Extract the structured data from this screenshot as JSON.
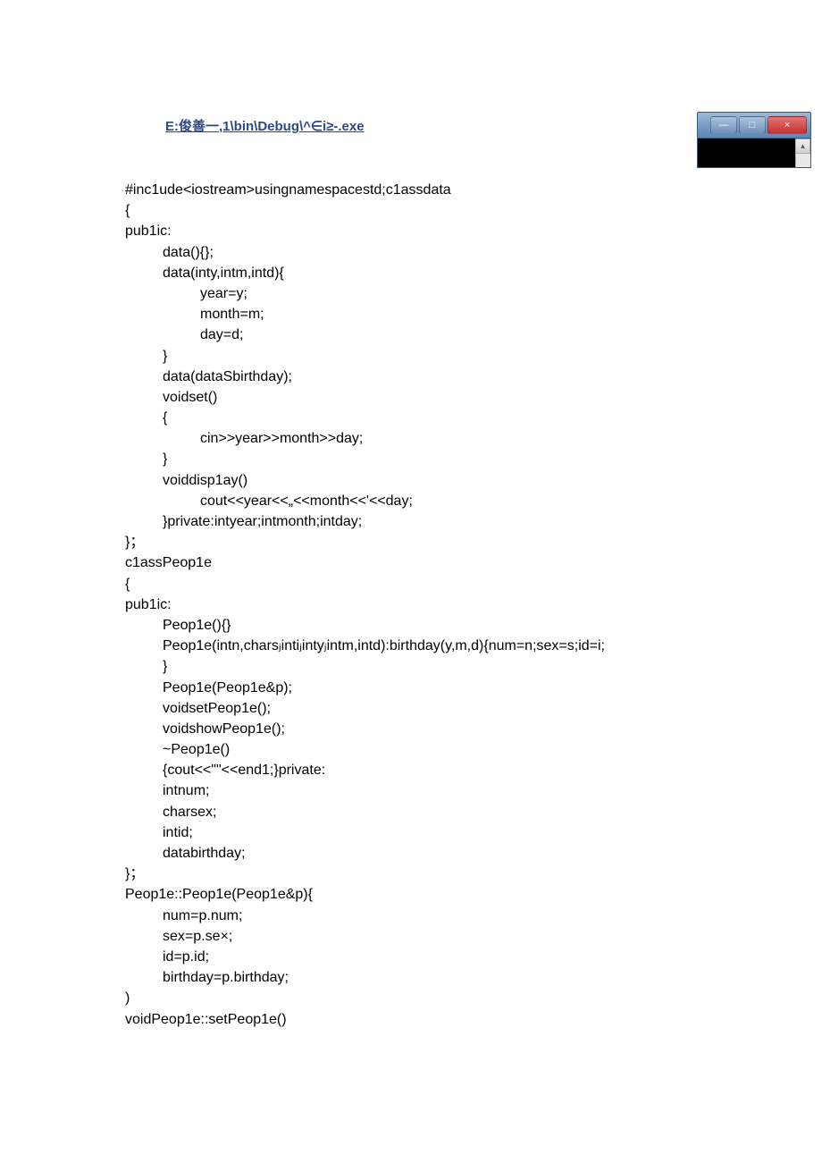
{
  "title_link": "E:俊善一,1\\bin\\Debug\\^∈i≥-.exe",
  "code_lines": [
    {
      "cls": "",
      "t": "#inc1ude<iostream>usingnamespacestd;c1assdata"
    },
    {
      "cls": "",
      "t": "{"
    },
    {
      "cls": "",
      "t": "pub1ic:"
    },
    {
      "cls": "indent1",
      "t": "data(){};"
    },
    {
      "cls": "indent1",
      "t": "data(inty,intm,intd){"
    },
    {
      "cls": "indent2",
      "t": "year=y;"
    },
    {
      "cls": "indent2",
      "t": "month=m;"
    },
    {
      "cls": "indent2",
      "t": "day=d;"
    },
    {
      "cls": "indent1",
      "t": "}"
    },
    {
      "cls": "indent1",
      "t": "data(dataSbirthday);"
    },
    {
      "cls": "indent1",
      "t": "voidset()"
    },
    {
      "cls": "indent1",
      "t": "{"
    },
    {
      "cls": "indent2",
      "t": "cin>>year>>month>>day;"
    },
    {
      "cls": "indent1",
      "t": "}"
    },
    {
      "cls": "indent1",
      "t": "voiddisp1ay()"
    },
    {
      "cls": "indent2",
      "t": "cout<<year<<„<<month<<'<<day;"
    },
    {
      "cls": "indent1",
      "t": "}private:intyear;intmonth;intday;"
    },
    {
      "cls": "",
      "t": "}；"
    },
    {
      "cls": "",
      "t": "c1assPeop1e"
    },
    {
      "cls": "",
      "t": "{"
    },
    {
      "cls": "",
      "t": "pub1ic:"
    },
    {
      "cls": "indent1",
      "t": "Peop1e(){}"
    },
    {
      "cls": "indent1",
      "t": "Peop1e(intn,charsⱼintiⱼintyⱼintm,intd):birthday(y,m,d){num=n;sex=s;id=i;"
    },
    {
      "cls": "indent1",
      "t": "}"
    },
    {
      "cls": "indent1",
      "t": "Peop1e(Peop1e&p);"
    },
    {
      "cls": "indent1",
      "t": "voidsetPeop1e();"
    },
    {
      "cls": "indent1",
      "t": "voidshowPeop1e();"
    },
    {
      "cls": "indent1",
      "t": "~Peop1e()"
    },
    {
      "cls": "indent1",
      "t": "{cout<<\"\"<<end1;}private:"
    },
    {
      "cls": "indent1",
      "t": "intnum;"
    },
    {
      "cls": "indent1",
      "t": "charsex;"
    },
    {
      "cls": "indent1",
      "t": "intid;"
    },
    {
      "cls": "indent1",
      "t": "databirthday;"
    },
    {
      "cls": "",
      "t": "}；"
    },
    {
      "cls": "",
      "t": "Peop1e::Peop1e(Peop1e&p){"
    },
    {
      "cls": "indent1",
      "t": "num=p.num;"
    },
    {
      "cls": "indent1",
      "t": "sex=p.se×;"
    },
    {
      "cls": "indent1",
      "t": "id=p.id;"
    },
    {
      "cls": "indent1",
      "t": "birthday=p.birthday;"
    },
    {
      "cls": "",
      "t": ")"
    },
    {
      "cls": "",
      "t": "voidPeop1e::setPeop1e()"
    }
  ],
  "window": {
    "minimize": "—",
    "maximize": "□",
    "close": "×",
    "scroll_up": "▴"
  }
}
